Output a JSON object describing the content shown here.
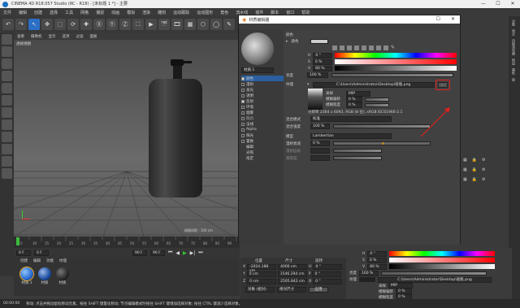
{
  "window": {
    "title": "CINEMA 4D R18.057 Studio (RC - R18) - [未标题 1 *] - 主要",
    "minimize_glyph": "—",
    "maximize_glyph": "☐",
    "close_glyph": "✕"
  },
  "menubar": {
    "items": [
      "文件",
      "编辑",
      "创建",
      "选择",
      "工具",
      "网格",
      "捕捉",
      "动画",
      "模拟",
      "渲染",
      "雕刻",
      "运动跟踪",
      "运动图形",
      "角色",
      "流水线",
      "插件",
      "脚本",
      "窗口",
      "帮助"
    ]
  },
  "toolbar": {
    "glyphs": [
      "↶",
      "↷",
      "↖",
      "✥",
      "⬚",
      "⟳",
      "✚",
      "Ⓧ",
      "Ⓨ",
      "Ⓩ",
      "⛶",
      "▶",
      "🎬",
      "🎞",
      "▦",
      "⬡",
      "◯",
      "✎",
      "⚙",
      "☀",
      "◐",
      "▣"
    ]
  },
  "viewport": {
    "menu": [
      "查看",
      "摄像机",
      "显示",
      "选项",
      "过滤",
      "面板"
    ],
    "label": "透视视图",
    "grid_label": "网格间距 : 100 cm"
  },
  "timeline": {
    "ticks": [
      "0",
      "5",
      "10",
      "15",
      "20",
      "25",
      "30",
      "35",
      "40",
      "45",
      "50",
      "55",
      "60",
      "65",
      "70",
      "75",
      "80",
      "85",
      "90"
    ],
    "start": "0 F",
    "current": "0 F",
    "end": "90 F",
    "end2": "90 F"
  },
  "materials": {
    "menu": [
      "创建",
      "编辑",
      "功能",
      "纹理"
    ],
    "items": [
      {
        "name": "材质.1",
        "color": "#2a6bd1"
      },
      {
        "name": "材质",
        "color": "#1b4ea0"
      },
      {
        "name": "材质",
        "color": "#2a2a2a"
      }
    ]
  },
  "coords": {
    "headers": [
      "位置",
      "尺寸",
      "旋转"
    ],
    "rows": [
      {
        "axis": "X",
        "pos": "-2024.188 cm",
        "size": "4000 cm",
        "rot_axis": "H",
        "rot": "0 °"
      },
      {
        "axis": "Y",
        "pos": "0 cm",
        "size": "1546.294 cm",
        "rot_axis": "P",
        "rot": "0 °"
      },
      {
        "axis": "Z",
        "pos": "0 cm",
        "size": "2505.842 cm",
        "rot_axis": "B",
        "rot": "0 °"
      }
    ],
    "mode": "对象 (相对)",
    "size_mode": "绝对尺寸",
    "apply": "应用"
  },
  "status": {
    "time": "00:00:00",
    "text": "移动: 点击并拖动鼠标移动元素。按住 SHIFT 键量化移动; 节点编辑模式时按住 SHIFT 键增加选择对象; 按住 CTRL 键减少选择对象。"
  },
  "right_panel": {
    "tabs": [
      "对象",
      "场次",
      "内容浏览器",
      "构造",
      "属性",
      "层"
    ]
  },
  "attr_lower": {
    "h": "0 °",
    "s": "0 %",
    "v": "80 %",
    "brightness_label": "亮度",
    "brightness": "100 %",
    "texture_label": "纹理",
    "path": "C:\\Users\\Administrator\\Desktop\\吸瓶.png",
    "sample_label": "采样",
    "sample": "MIP",
    "blur_offset_label": "模糊偏移",
    "blur_offset": "0 %",
    "blur_scale_label": "模糊程度",
    "blur_scale": "0 %"
  },
  "dialog": {
    "title": "材质编辑器",
    "menu": "",
    "material_name": "材质.1",
    "channels": [
      {
        "label": "颜色",
        "checked": true,
        "active": true
      },
      {
        "label": "漫射",
        "checked": false
      },
      {
        "label": "发光",
        "checked": false
      },
      {
        "label": "透明",
        "checked": false
      },
      {
        "label": "反射",
        "checked": true
      },
      {
        "label": "环境",
        "checked": false
      },
      {
        "label": "烟雾",
        "checked": false
      },
      {
        "label": "凹凸",
        "checked": false
      },
      {
        "label": "法线",
        "checked": false
      },
      {
        "label": "Alpha",
        "checked": false
      },
      {
        "label": "辉光",
        "checked": false
      },
      {
        "label": "置换",
        "checked": false
      },
      {
        "label": "编辑",
        "checked": false
      },
      {
        "label": "光照",
        "checked": false
      },
      {
        "label": "指定",
        "checked": false
      }
    ],
    "section": "颜色",
    "color_label": "颜色",
    "h_label": "H",
    "h": "0 °",
    "s_label": "S",
    "s": "0 %",
    "v_label": "V",
    "v": "80 %",
    "brightness_label": "亮度",
    "brightness": "100 %",
    "texture_label": "纹理",
    "texture_path": "C:\\Users\\Administrator\\Desktop\\吸瓶.png",
    "texture_btn": "...",
    "sample_label": "采样",
    "sample": "MIP",
    "blur_offset_label": "模糊偏移",
    "blur_offset": "0 %",
    "blur_scale_label": "模糊程度",
    "blur_scale": "0 %",
    "resolution": "分辨率 2364 x 6093, RGB (8 位), sRGB IEC61966-2.1",
    "mix_mode_label": "混合模式",
    "mix_mode": "标准",
    "mix_strength_label": "混合强度",
    "mix_strength": "100 %",
    "model_label": "模型",
    "model": "Lambertian",
    "diffuse_falloff_label": "漫射衰减",
    "diffuse_falloff": "0 %",
    "diffuse_level_label": "漫射层级",
    "diffuse_level": "",
    "roughness_label": "粗糙度",
    "roughness": ""
  }
}
